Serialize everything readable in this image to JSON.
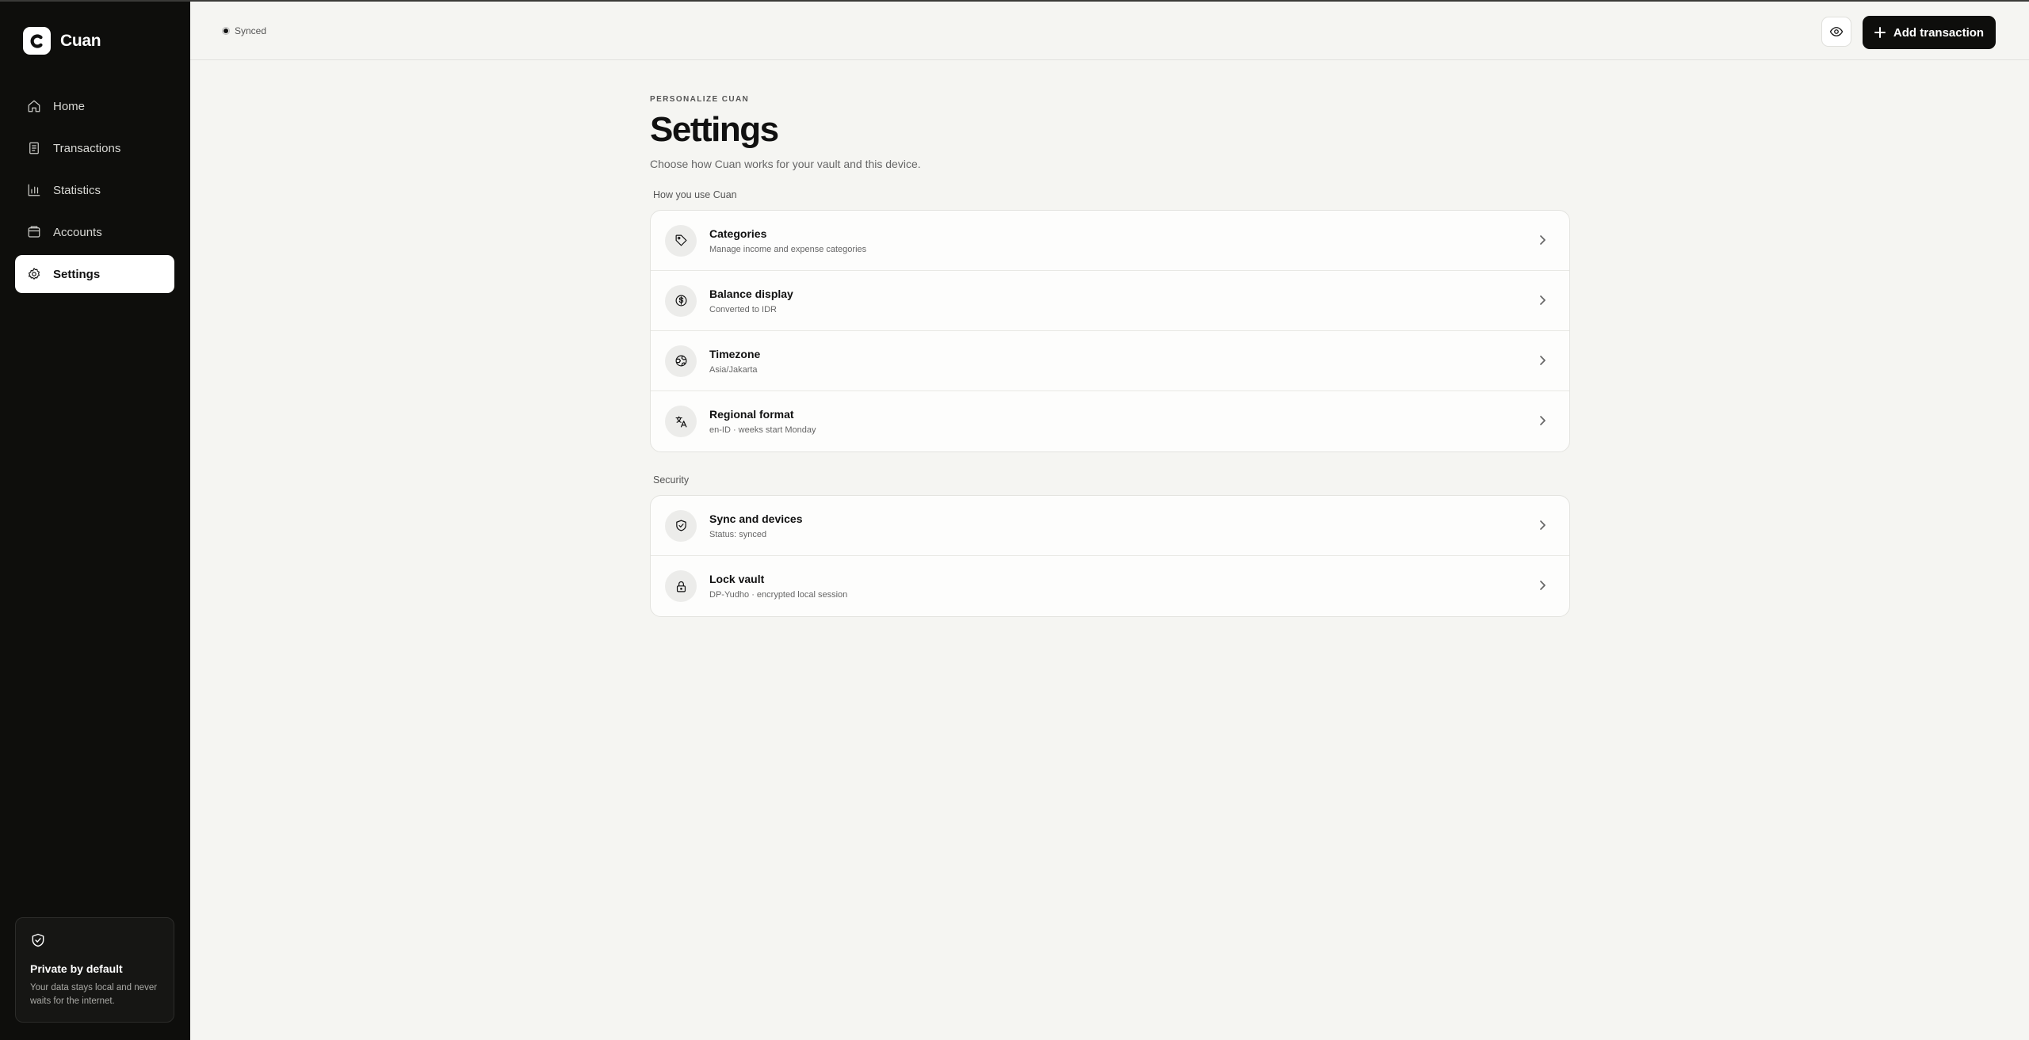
{
  "brand": {
    "name": "Cuan",
    "logo_letter": "C"
  },
  "sidebar": {
    "items": [
      {
        "label": "Home",
        "icon": "home-icon"
      },
      {
        "label": "Transactions",
        "icon": "receipt-icon"
      },
      {
        "label": "Statistics",
        "icon": "bar-chart-icon"
      },
      {
        "label": "Accounts",
        "icon": "wallet-icon"
      },
      {
        "label": "Settings",
        "icon": "gear-icon",
        "active": true
      }
    ],
    "privacy": {
      "title": "Private by default",
      "text": "Your data stays local and never waits for the internet."
    }
  },
  "topbar": {
    "status": "Synced",
    "add_label": "Add transaction"
  },
  "page": {
    "eyebrow": "PERSONALIZE CUAN",
    "title": "Settings",
    "subtitle": "Choose how Cuan works for your vault and this device."
  },
  "sections": [
    {
      "label": "How you use Cuan",
      "rows": [
        {
          "title": "Categories",
          "sub": "Manage income and expense categories",
          "icon": "tag-icon"
        },
        {
          "title": "Balance display",
          "sub": "Converted to IDR",
          "icon": "dollar-circle-icon"
        },
        {
          "title": "Timezone",
          "sub": "Asia/Jakarta",
          "icon": "globe-icon"
        },
        {
          "title": "Regional format",
          "sub": "en-ID · weeks start Monday",
          "icon": "language-icon"
        }
      ]
    },
    {
      "label": "Security",
      "rows": [
        {
          "title": "Sync and devices",
          "sub": "Status: synced",
          "icon": "shield-check-icon"
        },
        {
          "title": "Lock vault",
          "sub": "DP-Yudho · encrypted local session",
          "icon": "lock-icon"
        }
      ]
    }
  ],
  "colors": {
    "sidebar_bg": "#0e0e0c",
    "page_bg": "#f5f5f2",
    "accent": "#0e0e0c"
  }
}
